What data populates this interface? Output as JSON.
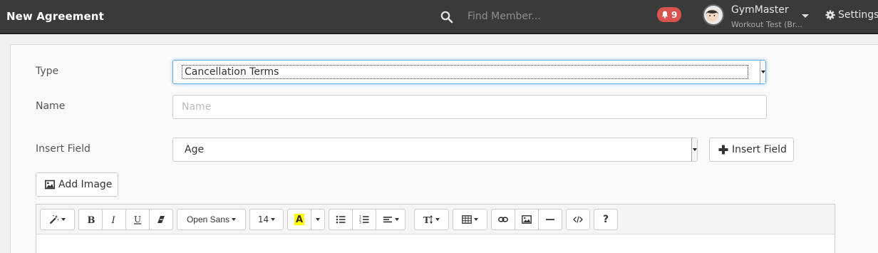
{
  "header": {
    "title": "New Agreement",
    "search_placeholder": "Find Member...",
    "notifications_count": "9",
    "user_name": "GymMaster",
    "user_location": "Workout Test (Br...",
    "settings_label": "Settings"
  },
  "form": {
    "type_label": "Type",
    "type_value": "Cancellation Terms",
    "name_label": "Name",
    "name_placeholder": "Name",
    "name_value": "",
    "insert_field_label": "Insert Field",
    "insert_field_value": "Age",
    "insert_field_button": "Insert Field",
    "add_image_button": "Add Image"
  },
  "toolbar": {
    "font_family": "Open Sans",
    "font_size": "14",
    "highlight_letter": "A",
    "highlight_color": "#ffff00",
    "help_label": "?"
  },
  "colors": {
    "topbar": "#3a3a3a",
    "badge": "#d9534f",
    "focus": "#66afe9"
  }
}
